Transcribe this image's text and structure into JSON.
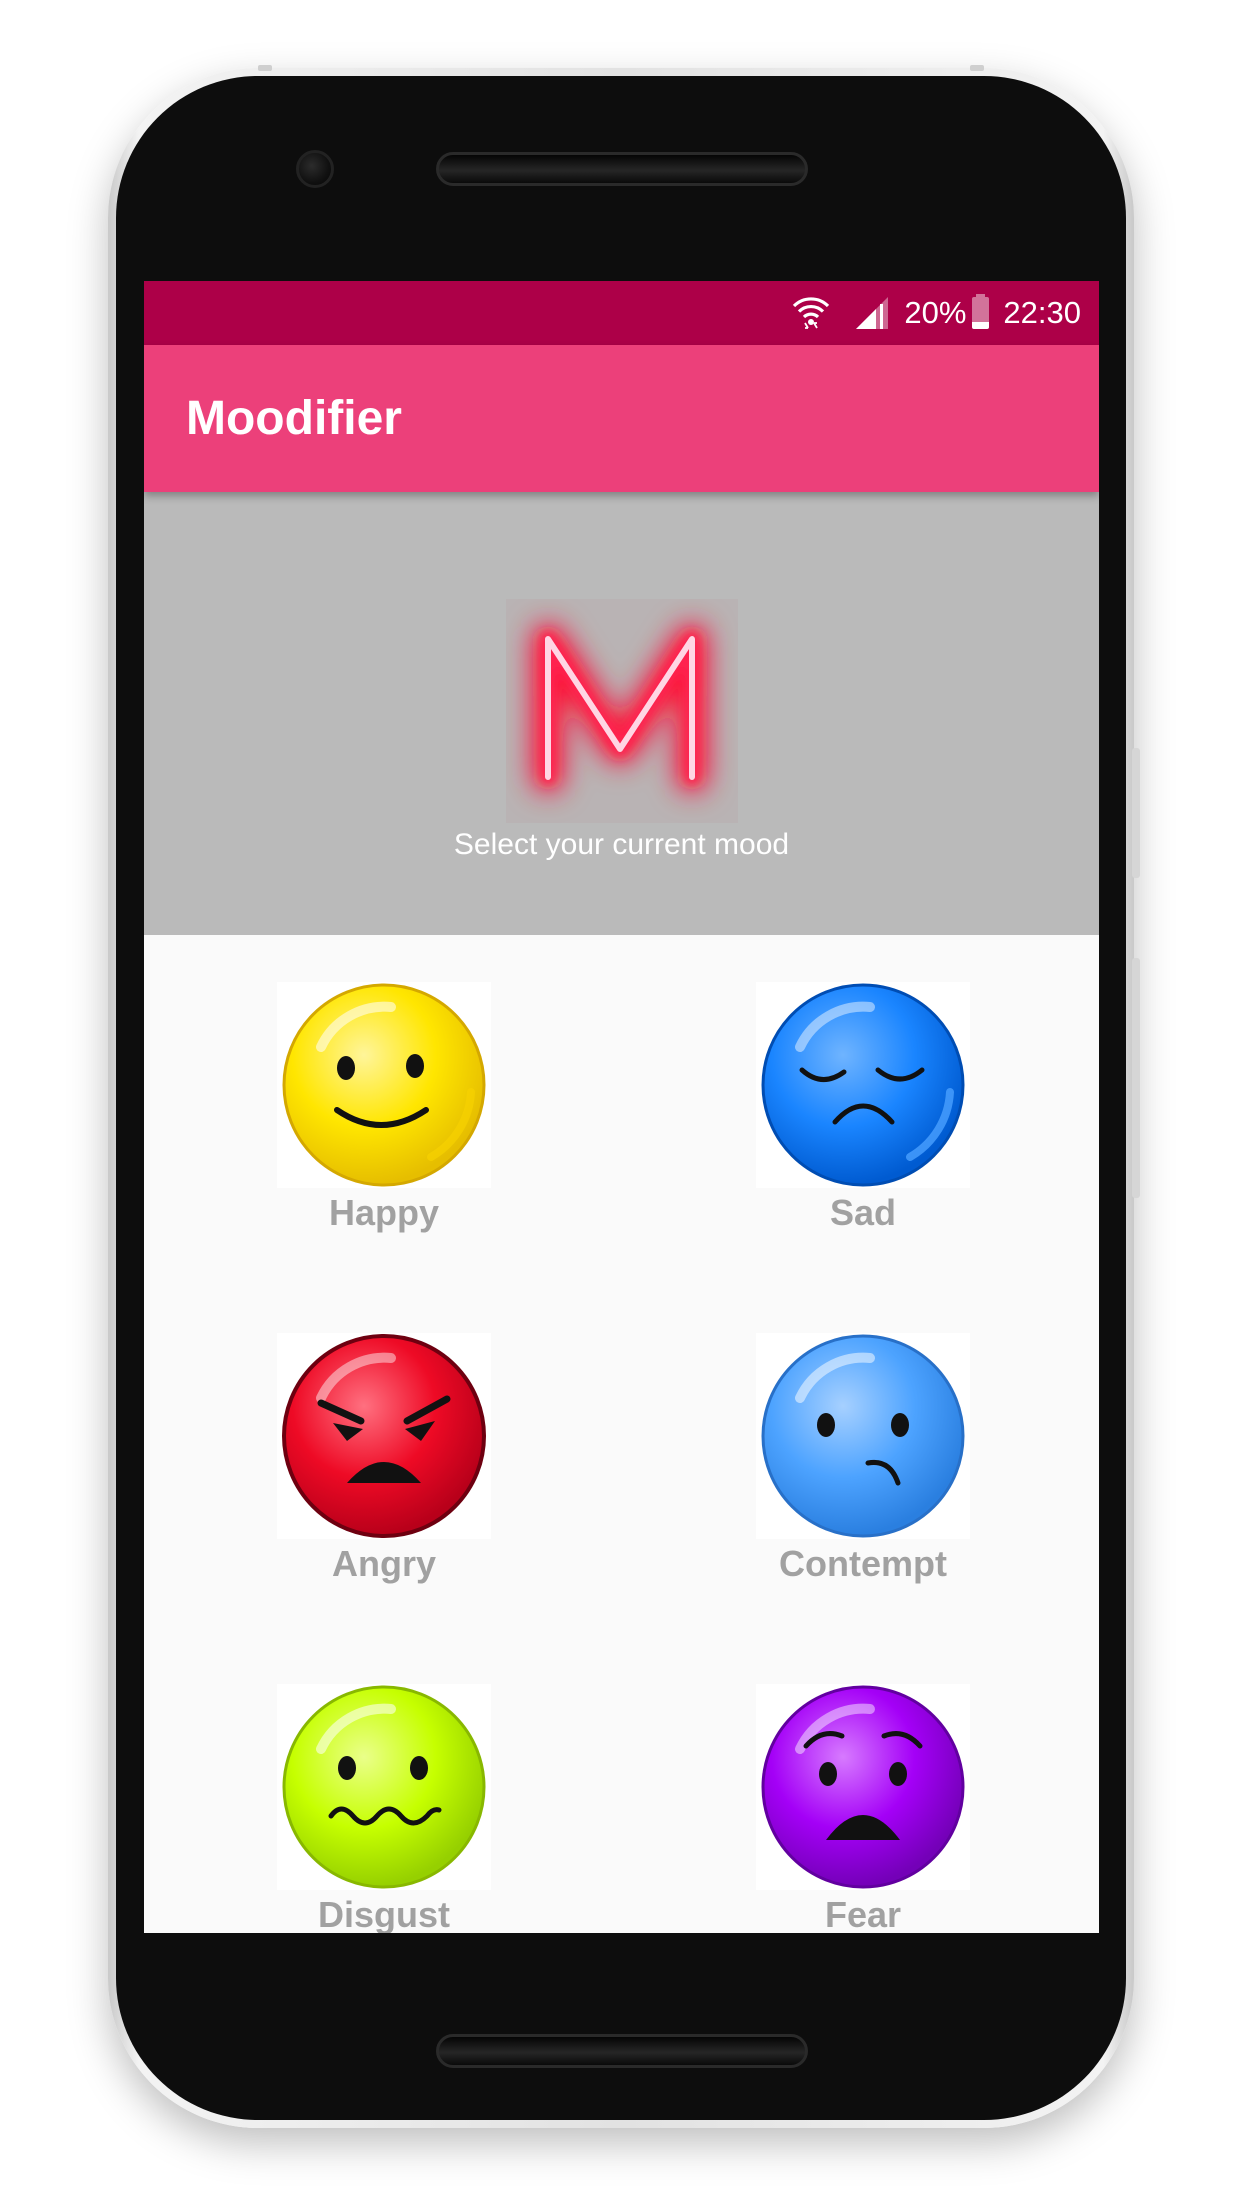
{
  "status_bar": {
    "battery_percent": "20%",
    "time": "22:30",
    "icons": [
      "wifi-icon",
      "signal-icon",
      "battery-icon"
    ]
  },
  "app_bar": {
    "title": "Moodifier"
  },
  "header": {
    "logo_letter": "M",
    "subtitle": "Select your current mood"
  },
  "moods": [
    {
      "label": "Happy",
      "icon": "happy-face-icon",
      "color": "#ffe000"
    },
    {
      "label": "Sad",
      "icon": "sad-face-icon",
      "color": "#1a85ff"
    },
    {
      "label": "Angry",
      "icon": "angry-face-icon",
      "color": "#ee0a25"
    },
    {
      "label": "Contempt",
      "icon": "contempt-face-icon",
      "color": "#4da3ff"
    },
    {
      "label": "Disgust",
      "icon": "disgust-face-icon",
      "color": "#c6ff00"
    },
    {
      "label": "Fear",
      "icon": "fear-face-icon",
      "color": "#a400f7"
    }
  ],
  "colors": {
    "status_bar": "#ad0048",
    "app_bar": "#ec407a",
    "hero_background": "#bababa",
    "label_gray": "#a1a1a1"
  }
}
